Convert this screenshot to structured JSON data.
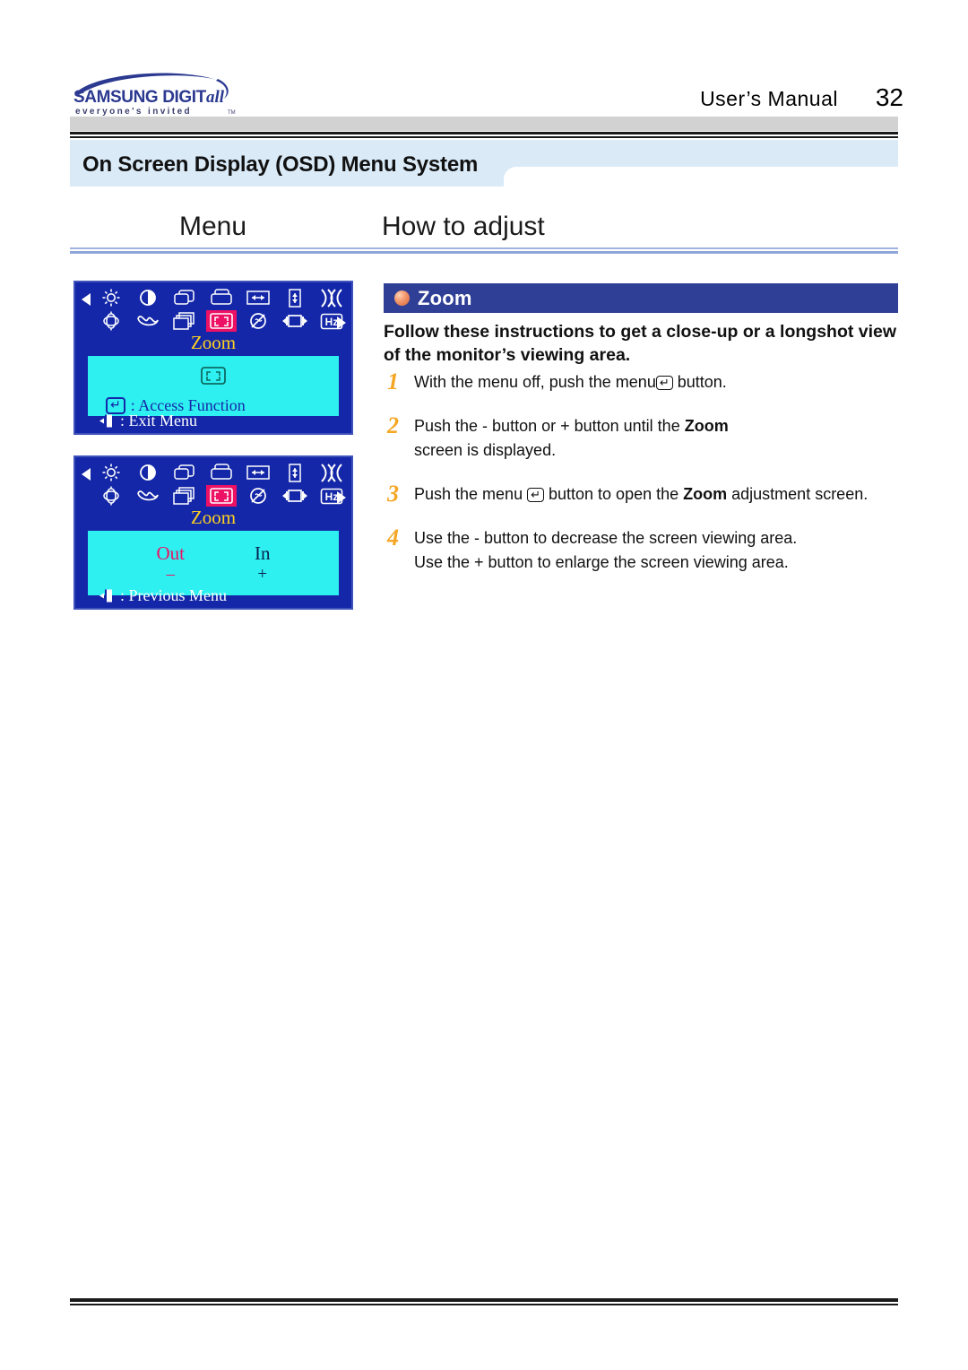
{
  "header": {
    "logo_primary": "SAMSUNG DIGITall",
    "logo_tagline": "everyone's invited",
    "logo_tm": "TM",
    "manual_label": "User’s Manual",
    "page_number": "32"
  },
  "section": {
    "title": "On Screen Display (OSD) Menu System",
    "column_menu": "Menu",
    "column_adjust": "How to adjust"
  },
  "osd_panels": [
    {
      "title": "Zoom",
      "icons_row1": [
        "brightness-icon",
        "contrast-icon",
        "h-position-icon",
        "v-position-icon",
        "h-size-icon",
        "v-size-icon",
        "pincushion-icon"
      ],
      "icons_row2": [
        "rotation-icon",
        "pinbalance-icon",
        "trapezoid-icon",
        "zoom-icon",
        "degauss-icon",
        "parallelogram-icon",
        "frequency-icon"
      ],
      "selected_icon": "zoom-icon",
      "body_icon": "zoom-icon",
      "access_label": ": Access Function",
      "exit_label": ": Exit Menu"
    },
    {
      "title": "Zoom",
      "icons_row1": [
        "brightness-icon",
        "contrast-icon",
        "h-position-icon",
        "v-position-icon",
        "h-size-icon",
        "v-size-icon",
        "pincushion-icon"
      ],
      "icons_row2": [
        "rotation-icon",
        "pinbalance-icon",
        "trapezoid-icon",
        "zoom-icon",
        "degauss-icon",
        "parallelogram-icon",
        "frequency-icon"
      ],
      "selected_icon": "zoom-icon",
      "out_label": "Out",
      "out_symbol": "–",
      "in_label": "In",
      "in_symbol": "+",
      "previous_label": ": Previous Menu"
    }
  ],
  "instructions": {
    "bullet": "orange-sphere-bullet",
    "heading": "Zoom",
    "intro_line1": "Follow these instructions to get a close-up or a longshot view",
    "intro_line2": "of the monitor’s viewing area.",
    "steps": [
      {
        "number": "1",
        "pre": "With the menu off, push the menu",
        "key": "↵",
        "post": " button."
      },
      {
        "number": "2",
        "pre": "Push the  - button or  + button until the ",
        "bold": "Zoom",
        "post": "",
        "line2": "screen is displayed."
      },
      {
        "number": "3",
        "pre": "Push the menu ",
        "key": "↵",
        "mid": " button to open the ",
        "bold": "Zoom",
        "post": " adjustment screen."
      },
      {
        "number": "4",
        "pre": "Use the  - button to decrease the screen viewing area.",
        "line2": "Use the  + button to enlarge the screen viewing area."
      }
    ]
  },
  "colors": {
    "osd_background": "#1427a8",
    "osd_body": "#2ff0f0",
    "osd_title": "#ffd21e",
    "osd_selected": "#ec1164",
    "section_tab": "#daeaf7",
    "zoom_bar": "#2f3f96",
    "step_number": "#f5a623",
    "logo_blue": "#2b3990"
  }
}
